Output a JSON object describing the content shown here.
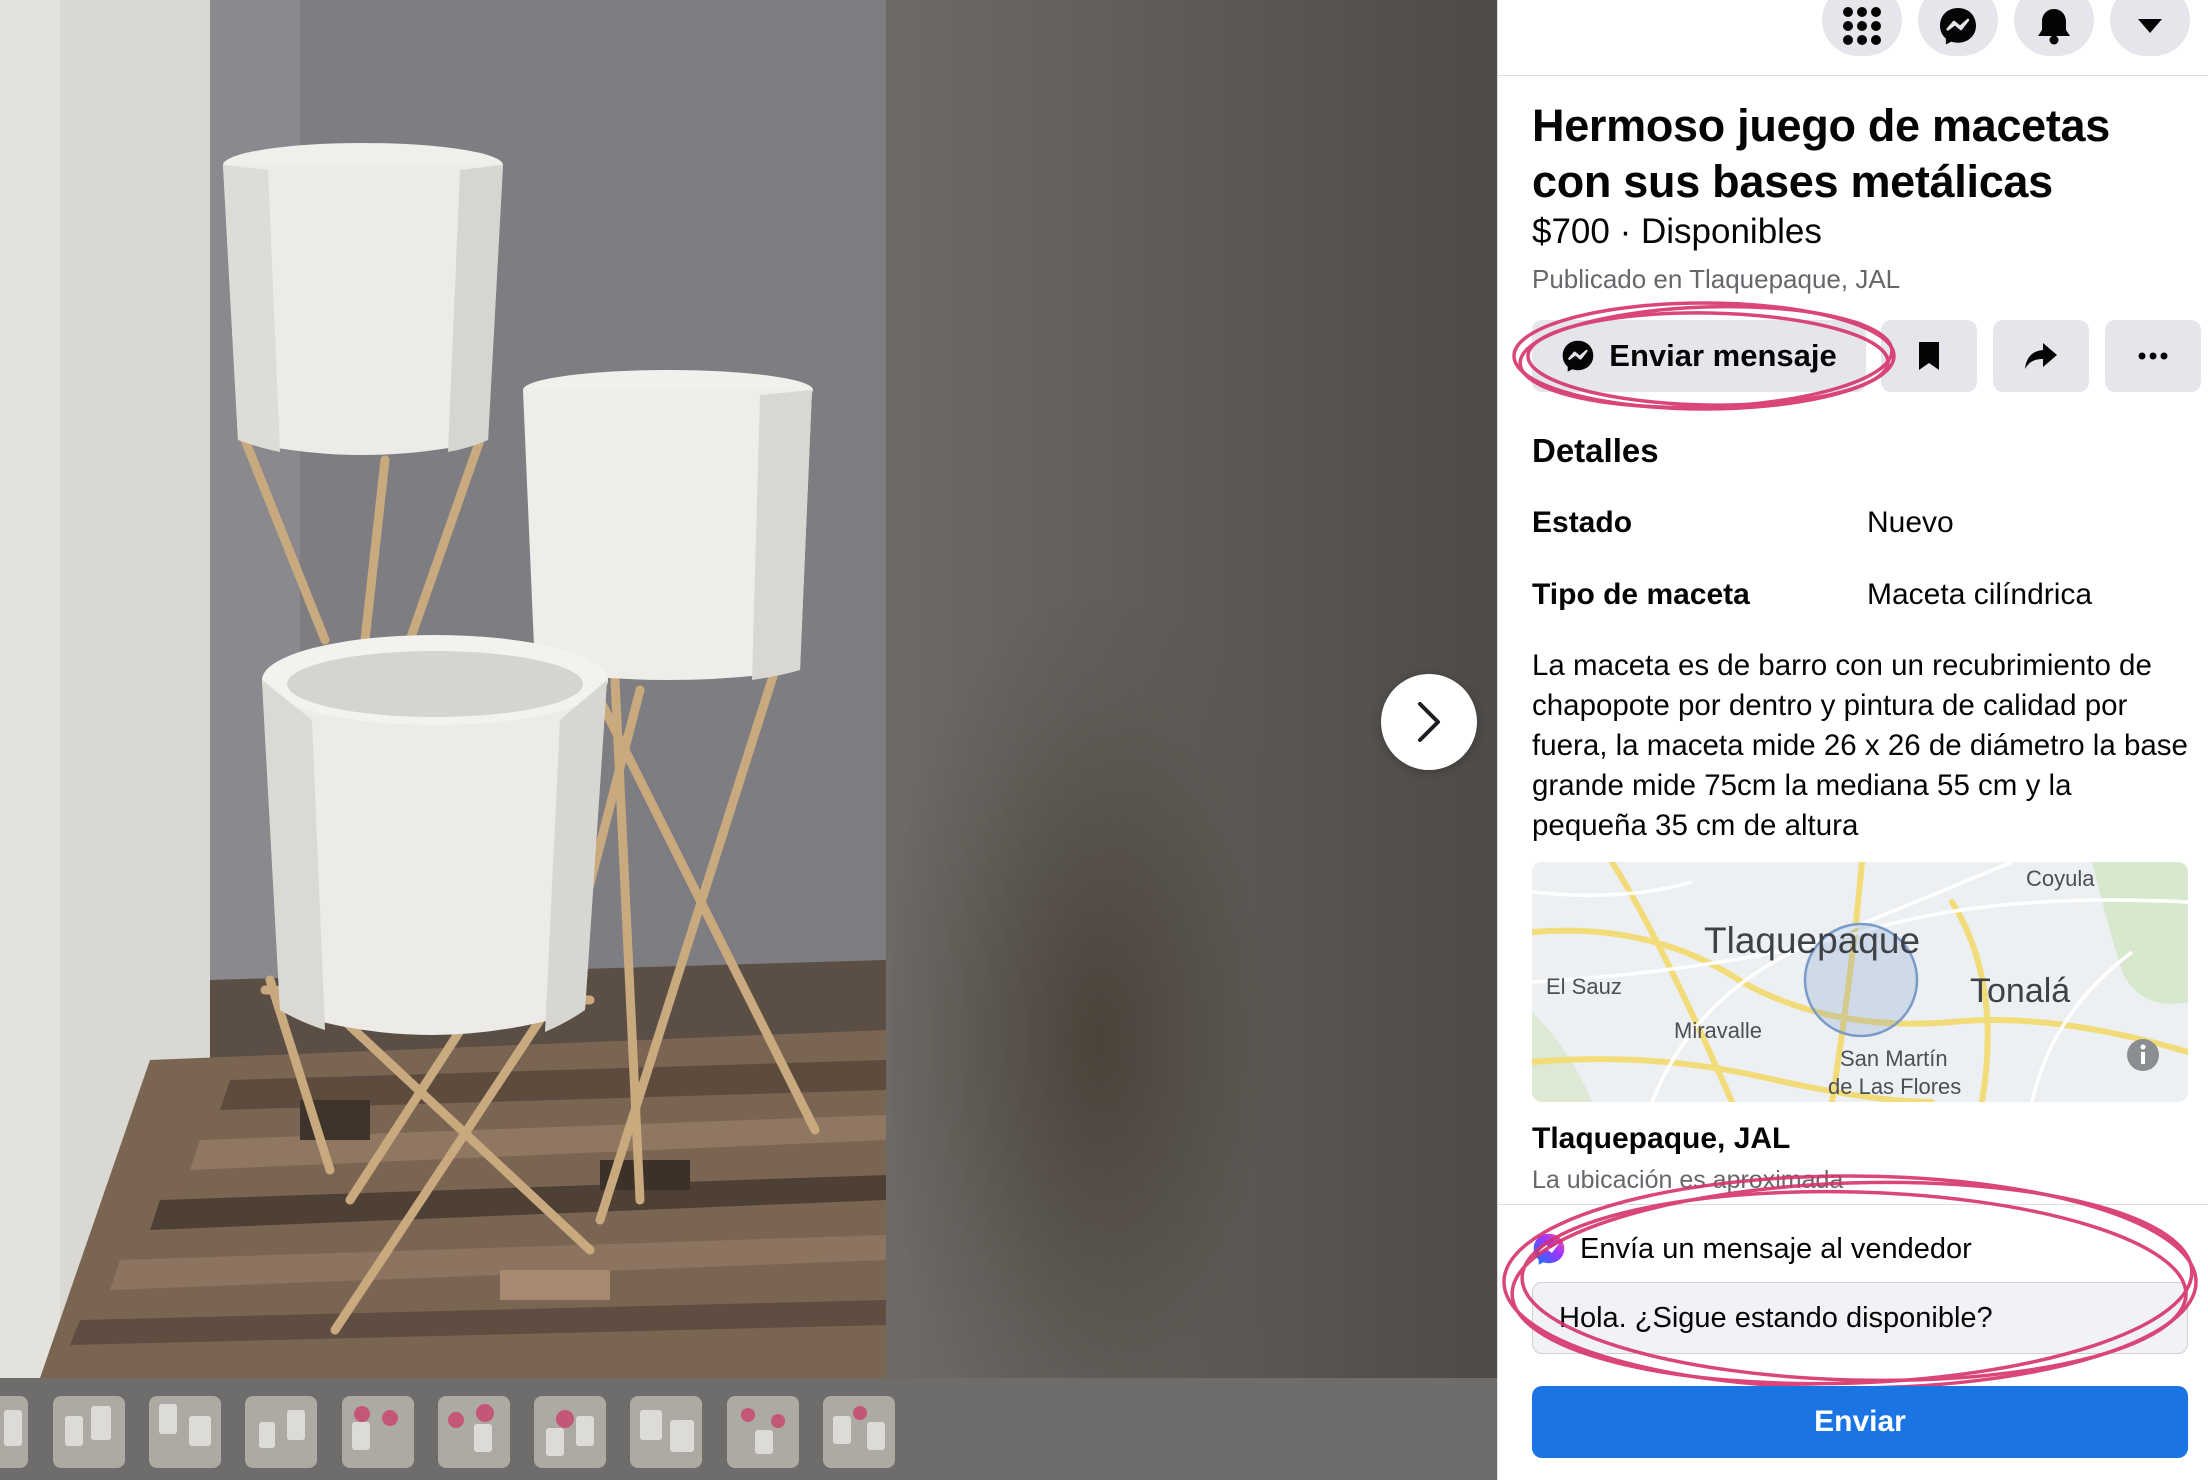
{
  "listing": {
    "title": "Hermoso juego de macetas con sus bases metálicas",
    "price_line": "$700 · Disponibles",
    "published": "Publicado en Tlaquepaque, JAL"
  },
  "actions": {
    "message_label": "Enviar mensaje"
  },
  "details": {
    "heading": "Detalles",
    "rows": [
      {
        "key": "Estado",
        "value": "Nuevo"
      },
      {
        "key": "Tipo de maceta",
        "value": "Maceta cilíndrica"
      }
    ],
    "description": "La maceta es de barro con un recubrimiento de chapopote por dentro y pintura de calidad por fuera, la maceta mide 26 x 26 de diámetro la base grande mide 75cm la mediana 55 cm y la pequeña 35 cm de altura"
  },
  "map": {
    "labels": {
      "coyula": "Coyula",
      "tlaquepaque": "Tlaquepaque",
      "el_sauz": "El Sauz",
      "tonala": "Tonalá",
      "miravalle": "Miravalle",
      "san_martin_1": "San Martín",
      "san_martin_2": "de Las Flores"
    }
  },
  "location": {
    "title": "Tlaquepaque, JAL",
    "subtitle": "La ubicación es aproximada"
  },
  "seller_message": {
    "heading": "Envía un mensaje al vendedor",
    "input_value": "Hola. ¿Sigue estando disponible?",
    "send_label": "Enviar"
  },
  "icons": {
    "topbar": [
      "menu-grid-icon",
      "messenger-icon",
      "bell-icon",
      "caret-down-icon"
    ],
    "actions": [
      "bookmark-icon",
      "share-icon",
      "more-icon"
    ],
    "viewer": [
      "chevron-right-icon"
    ]
  },
  "colors": {
    "accent": "#1b74e4",
    "annotation": "#d6336c",
    "notification": "#e41e3f"
  }
}
